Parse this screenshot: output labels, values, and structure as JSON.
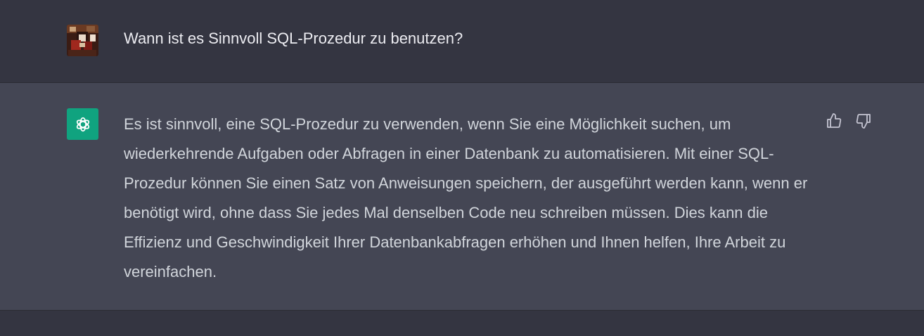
{
  "conversation": {
    "user_message": "Wann ist es Sinnvoll SQL-Prozedur zu benutzen?",
    "assistant_message": "Es ist sinnvoll, eine SQL-Prozedur zu verwenden, wenn Sie eine Möglichkeit suchen, um wiederkehrende Aufgaben oder Abfragen in einer Datenbank zu automatisieren. Mit einer SQL-Prozedur können Sie einen Satz von Anweisungen speichern, der ausgeführt werden kann, wenn er benötigt wird, ohne dass Sie jedes Mal denselben Code neu schreiben müssen. Dies kann die Effizienz und Geschwindigkeit Ihrer Datenbankabfragen erhöhen und Ihnen helfen, Ihre Arbeit zu vereinfachen."
  },
  "icons": {
    "user_avatar": "user-avatar",
    "assistant_avatar": "openai-logo-icon",
    "thumbs_up": "thumbs-up-icon",
    "thumbs_down": "thumbs-down-icon"
  },
  "colors": {
    "page_background": "#343541",
    "assistant_background": "#444654",
    "assistant_avatar": "#10a37f",
    "user_text": "#ececf1",
    "assistant_text": "#d1d5db",
    "icon": "#c5c5d2"
  }
}
